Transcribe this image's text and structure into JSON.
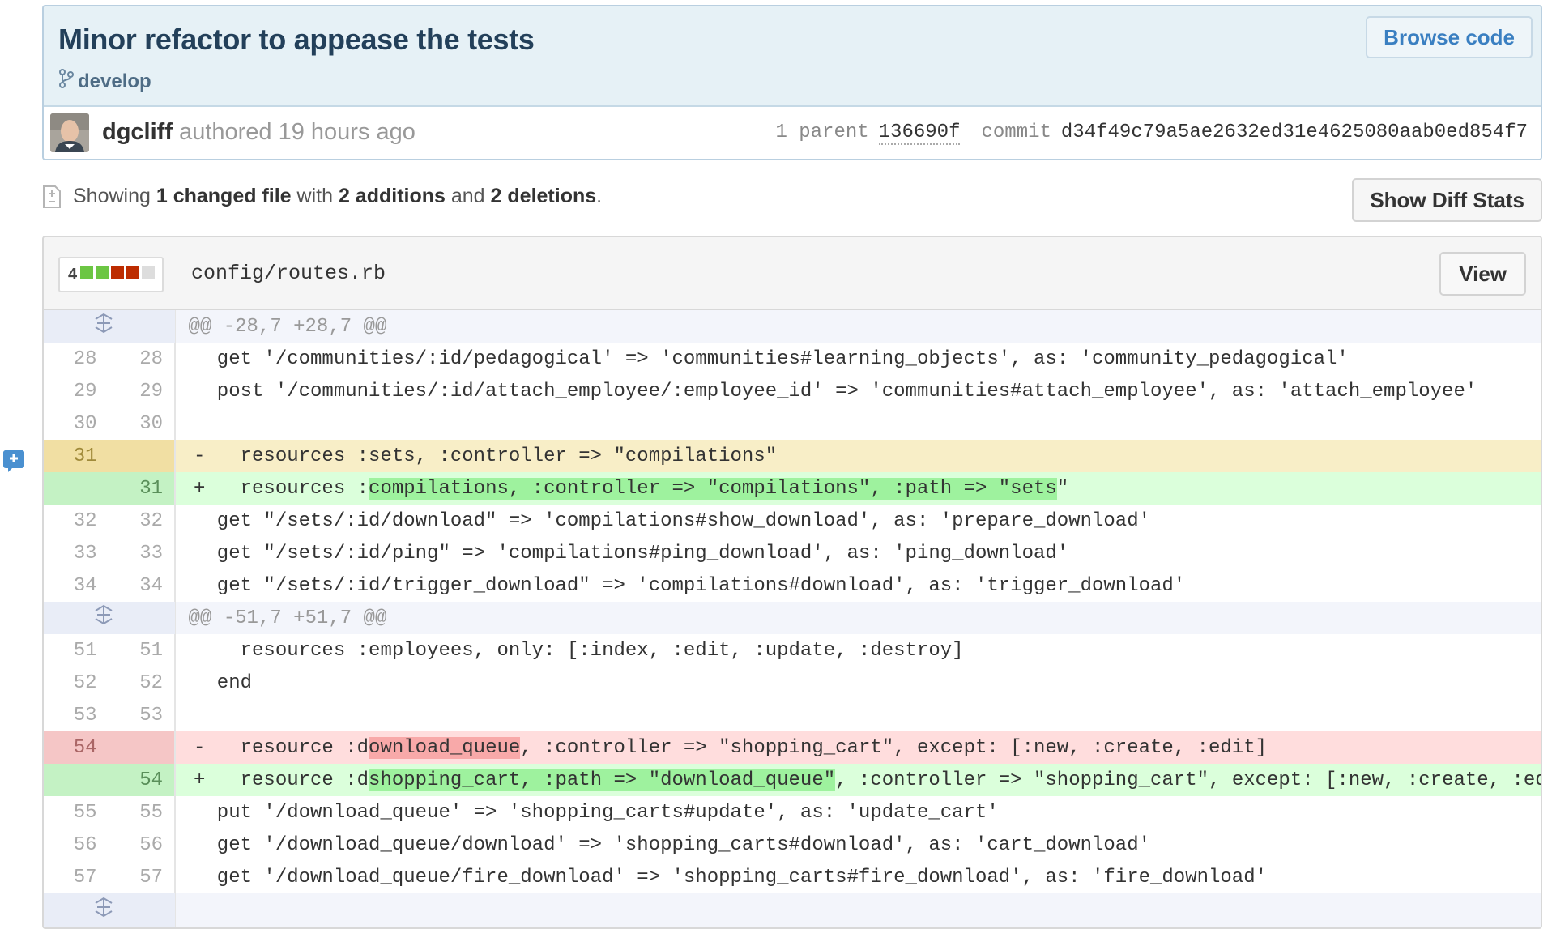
{
  "commit": {
    "title": "Minor refactor to appease the tests",
    "branch": "develop",
    "browse_label": "Browse code",
    "author": "dgcliff",
    "authored_text": "authored 19 hours ago",
    "parent_label": "1 parent",
    "parent_sha": "136690f",
    "commit_label": "commit",
    "commit_sha": "d34f49c79a5ae2632ed31e4625080aab0ed854f7"
  },
  "summary": {
    "showing": "Showing",
    "changed": "1 changed file",
    "with": "with",
    "additions": "2 additions",
    "and": "and",
    "deletions": "2 deletions",
    "period": ".",
    "diff_stats_label": "Show Diff Stats"
  },
  "file": {
    "changes": "4",
    "stat_colors": [
      "#6cc644",
      "#6cc644",
      "#bd2c00",
      "#bd2c00",
      "#dddddd"
    ],
    "name": "config/routes.rb",
    "view_label": "View"
  },
  "diff": [
    {
      "type": "hunk",
      "text": "@@ -28,7 +28,7 @@"
    },
    {
      "type": "ctx",
      "old": "28",
      "new": "28",
      "text": "  get '/communities/:id/pedagogical' => 'communities#learning_objects', as: 'community_pedagogical'"
    },
    {
      "type": "ctx",
      "old": "29",
      "new": "29",
      "text": "  post '/communities/:id/attach_employee/:employee_id' => 'communities#attach_employee', as: 'attach_employee'"
    },
    {
      "type": "ctx",
      "old": "30",
      "new": "30",
      "text": ""
    },
    {
      "type": "del-hl",
      "old": "31",
      "new": "",
      "text": "-   resources :sets, :controller => \"compilations\""
    },
    {
      "type": "add",
      "old": "",
      "new": "31",
      "pre": "+   resources :",
      "mark": "compilations, :controller => \"compilations\", :path => \"sets",
      "post": "\""
    },
    {
      "type": "ctx",
      "old": "32",
      "new": "32",
      "text": "  get \"/sets/:id/download\" => 'compilations#show_download', as: 'prepare_download'"
    },
    {
      "type": "ctx",
      "old": "33",
      "new": "33",
      "text": "  get \"/sets/:id/ping\" => 'compilations#ping_download', as: 'ping_download'"
    },
    {
      "type": "ctx",
      "old": "34",
      "new": "34",
      "text": "  get \"/sets/:id/trigger_download\" => 'compilations#download', as: 'trigger_download'"
    },
    {
      "type": "hunk",
      "text": "@@ -51,7 +51,7 @@"
    },
    {
      "type": "ctx",
      "old": "51",
      "new": "51",
      "text": "    resources :employees, only: [:index, :edit, :update, :destroy]"
    },
    {
      "type": "ctx",
      "old": "52",
      "new": "52",
      "text": "  end"
    },
    {
      "type": "ctx",
      "old": "53",
      "new": "53",
      "text": ""
    },
    {
      "type": "del",
      "old": "54",
      "new": "",
      "pre": "-   resource :d",
      "mark": "ownload_queue",
      "post": ", :controller => \"shopping_cart\", except: [:new, :create, :edit]"
    },
    {
      "type": "add",
      "old": "",
      "new": "54",
      "pre": "+   resource :d",
      "mark": "shopping_cart, :path => \"download_queue\"",
      "post": ", :controller => \"shopping_cart\", except: [:new, :create, :edit]"
    },
    {
      "type": "ctx",
      "old": "55",
      "new": "55",
      "text": "  put '/download_queue' => 'shopping_carts#update', as: 'update_cart'"
    },
    {
      "type": "ctx",
      "old": "56",
      "new": "56",
      "text": "  get '/download_queue/download' => 'shopping_carts#download', as: 'cart_download'"
    },
    {
      "type": "ctx",
      "old": "57",
      "new": "57",
      "text": "  get '/download_queue/fire_download' => 'shopping_carts#fire_download', as: 'fire_download'"
    }
  ]
}
